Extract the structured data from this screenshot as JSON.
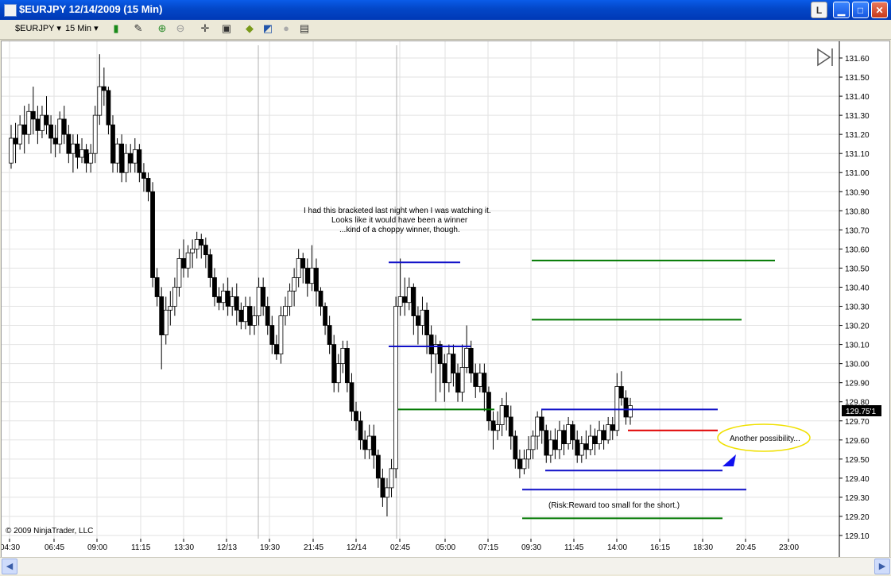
{
  "window": {
    "title": "$EURJPY  12/14/2009 (15 Min)",
    "btn_l": "L",
    "btn_min": "▁",
    "btn_max": "□",
    "btn_close": "✕"
  },
  "toolbar": {
    "instrument": "$EURJPY",
    "interval": "15 Min"
  },
  "chart": {
    "copyright": "© 2009 NinjaTrader, LLC",
    "last_price": "129.75'1",
    "annotation_lines": [
      "I had this bracketed last night when I was watching it.",
      "Looks like it would have been a winner",
      "...kind of a choppy winner, though."
    ],
    "possibility_label": "Another possibility...",
    "risk_note": "(Risk:Reward too small for the short.)",
    "price_labels": [
      "131.60",
      "131.50",
      "131.40",
      "131.30",
      "131.20",
      "131.10",
      "131.00",
      "130.90",
      "130.80",
      "130.70",
      "130.60",
      "130.50",
      "130.40",
      "130.30",
      "130.20",
      "130.10",
      "130.00",
      "129.90",
      "129.80",
      "129.70",
      "129.60",
      "129.50",
      "129.40",
      "129.30",
      "129.20",
      "129.10"
    ],
    "time_labels": [
      "04:30",
      "06:45",
      "09:00",
      "11:15",
      "13:30",
      "12/13",
      "19:30",
      "21:45",
      "12/14",
      "02:45",
      "05:00",
      "07:15",
      "09:30",
      "11:45",
      "14:00",
      "16:15",
      "18:30",
      "20:45",
      "23:00"
    ],
    "colors": {
      "blue": "#1010c8",
      "green": "#007800",
      "red": "#e00000",
      "ellipse": "#f0e000"
    }
  },
  "chart_data": {
    "type": "candlestick",
    "y_axis_range": [
      129.1,
      131.65
    ],
    "hlines": [
      {
        "color": "blue",
        "price": 130.53
      },
      {
        "color": "blue",
        "price": 130.09
      },
      {
        "color": "green",
        "price": 129.76
      },
      {
        "color": "green",
        "price": 130.54
      },
      {
        "color": "green",
        "price": 130.23
      },
      {
        "color": "blue",
        "price": 129.76
      },
      {
        "color": "red",
        "price": 129.65
      },
      {
        "color": "blue",
        "price": 129.44
      },
      {
        "color": "blue",
        "price": 129.34
      },
      {
        "color": "green",
        "price": 129.19
      }
    ],
    "candles": [
      [
        131.05,
        131.18,
        131.25,
        131.02
      ],
      [
        131.18,
        131.15,
        131.26,
        131.05
      ],
      [
        131.15,
        131.25,
        131.3,
        131.12
      ],
      [
        131.25,
        131.2,
        131.35,
        131.1
      ],
      [
        131.2,
        131.32,
        131.36,
        131.15
      ],
      [
        131.32,
        131.28,
        131.45,
        131.2
      ],
      [
        131.28,
        131.22,
        131.35,
        131.15
      ],
      [
        131.22,
        131.3,
        131.35,
        131.18
      ],
      [
        131.3,
        131.25,
        131.4,
        131.2
      ],
      [
        131.25,
        131.18,
        131.3,
        131.1
      ],
      [
        131.18,
        131.15,
        131.25,
        131.08
      ],
      [
        131.15,
        131.28,
        131.32,
        131.1
      ],
      [
        131.28,
        131.2,
        131.35,
        131.15
      ],
      [
        131.2,
        131.1,
        131.25,
        131.05
      ],
      [
        131.1,
        131.15,
        131.2,
        131.0
      ],
      [
        131.15,
        131.08,
        131.2,
        131.02
      ],
      [
        131.08,
        131.12,
        131.18,
        131.05
      ],
      [
        131.12,
        131.05,
        131.15,
        131.0
      ],
      [
        131.05,
        131.1,
        131.15,
        131.0
      ],
      [
        131.1,
        131.3,
        131.35,
        131.05
      ],
      [
        131.3,
        131.45,
        131.62,
        131.25
      ],
      [
        131.45,
        131.43,
        131.55,
        131.35
      ],
      [
        131.43,
        131.25,
        131.45,
        131.2
      ],
      [
        131.25,
        131.05,
        131.3,
        131.0
      ],
      [
        131.05,
        131.15,
        131.18,
        131.0
      ],
      [
        131.15,
        131.0,
        131.2,
        130.95
      ],
      [
        131.0,
        131.1,
        131.15,
        130.95
      ],
      [
        131.1,
        131.05,
        131.15,
        131.0
      ],
      [
        131.05,
        131.12,
        131.18,
        131.0
      ],
      [
        131.12,
        131.0,
        131.15,
        130.95
      ],
      [
        131.0,
        130.97,
        131.05,
        130.9
      ],
      [
        130.97,
        130.9,
        131.0,
        130.85
      ],
      [
        130.9,
        130.45,
        130.95,
        130.4
      ],
      [
        130.45,
        130.35,
        130.5,
        130.3
      ],
      [
        130.35,
        130.15,
        130.4,
        129.97
      ],
      [
        130.15,
        130.28,
        130.35,
        130.1
      ],
      [
        130.28,
        130.3,
        130.38,
        130.2
      ],
      [
        130.3,
        130.4,
        130.45,
        130.25
      ],
      [
        130.4,
        130.55,
        130.6,
        130.35
      ],
      [
        130.55,
        130.5,
        130.65,
        130.45
      ],
      [
        130.5,
        130.58,
        130.62,
        130.45
      ],
      [
        130.58,
        130.6,
        130.65,
        130.5
      ],
      [
        130.6,
        130.65,
        130.69,
        130.55
      ],
      [
        130.65,
        130.62,
        130.68,
        130.55
      ],
      [
        130.62,
        130.57,
        130.66,
        130.5
      ],
      [
        130.57,
        130.45,
        130.6,
        130.4
      ],
      [
        130.45,
        130.35,
        130.5,
        130.3
      ],
      [
        130.35,
        130.32,
        130.4,
        130.28
      ],
      [
        130.32,
        130.38,
        130.42,
        130.28
      ],
      [
        130.38,
        130.3,
        130.45,
        130.25
      ],
      [
        130.3,
        130.35,
        130.4,
        130.25
      ],
      [
        130.35,
        130.28,
        130.42,
        130.2
      ],
      [
        130.28,
        130.22,
        130.32,
        130.18
      ],
      [
        130.22,
        130.3,
        130.35,
        130.18
      ],
      [
        130.3,
        130.2,
        130.35,
        130.15
      ],
      [
        130.2,
        130.25,
        130.3,
        130.15
      ],
      [
        130.25,
        130.4,
        130.45,
        130.2
      ],
      [
        130.4,
        130.3,
        130.45,
        130.25
      ],
      [
        130.3,
        130.2,
        130.35,
        130.15
      ],
      [
        130.2,
        130.1,
        130.25,
        130.05
      ],
      [
        130.1,
        130.05,
        130.15,
        130.02
      ],
      [
        130.05,
        130.25,
        130.3,
        130.0
      ],
      [
        130.25,
        130.3,
        130.35,
        130.2
      ],
      [
        130.3,
        130.38,
        130.42,
        130.25
      ],
      [
        130.38,
        130.45,
        130.5,
        130.3
      ],
      [
        130.45,
        130.55,
        130.6,
        130.4
      ],
      [
        130.55,
        130.5,
        130.58,
        130.42
      ],
      [
        130.5,
        130.42,
        130.55,
        130.35
      ],
      [
        130.42,
        130.5,
        130.62,
        130.38
      ],
      [
        130.5,
        130.38,
        130.55,
        130.3
      ],
      [
        130.38,
        130.3,
        130.4,
        130.25
      ],
      [
        130.3,
        130.2,
        130.32,
        130.15
      ],
      [
        130.2,
        130.1,
        130.25,
        130.05
      ],
      [
        130.1,
        129.9,
        130.15,
        129.85
      ],
      [
        129.9,
        130.0,
        130.05,
        129.85
      ],
      [
        130.0,
        130.08,
        130.12,
        129.95
      ],
      [
        130.08,
        129.9,
        130.12,
        129.85
      ],
      [
        129.9,
        129.75,
        129.95,
        129.7
      ],
      [
        129.75,
        129.7,
        129.8,
        129.65
      ],
      [
        129.7,
        129.6,
        129.75,
        129.55
      ],
      [
        129.6,
        129.55,
        129.65,
        129.5
      ],
      [
        129.55,
        129.62,
        129.68,
        129.5
      ],
      [
        129.62,
        129.52,
        129.68,
        129.45
      ],
      [
        129.52,
        129.4,
        129.55,
        129.35
      ],
      [
        129.4,
        129.3,
        129.45,
        129.25
      ],
      [
        129.3,
        129.35,
        129.4,
        129.2
      ],
      [
        129.35,
        129.45,
        129.5,
        129.3
      ],
      [
        129.45,
        130.3,
        130.35,
        129.4
      ],
      [
        130.3,
        130.35,
        130.55,
        130.25
      ],
      [
        130.35,
        130.32,
        130.45,
        130.25
      ],
      [
        130.32,
        130.4,
        130.45,
        130.28
      ],
      [
        130.4,
        130.25,
        130.42,
        130.15
      ],
      [
        130.25,
        130.2,
        130.3,
        130.1
      ],
      [
        130.2,
        130.28,
        130.35,
        130.15
      ],
      [
        130.28,
        130.15,
        130.32,
        130.05
      ],
      [
        130.15,
        130.05,
        130.2,
        129.95
      ],
      [
        130.05,
        130.1,
        130.15,
        129.8
      ],
      [
        130.1,
        130.0,
        130.12,
        129.85
      ],
      [
        130.0,
        129.9,
        130.05,
        129.8
      ],
      [
        129.9,
        130.05,
        130.1,
        129.85
      ],
      [
        130.05,
        129.95,
        130.1,
        129.88
      ],
      [
        129.95,
        129.85,
        130.0,
        129.8
      ],
      [
        129.85,
        129.98,
        130.1,
        129.8
      ],
      [
        129.98,
        130.08,
        130.2,
        129.95
      ],
      [
        130.08,
        129.95,
        130.12,
        129.9
      ],
      [
        129.95,
        129.88,
        130.0,
        129.82
      ],
      [
        129.88,
        129.95,
        130.0,
        129.85
      ],
      [
        129.95,
        129.85,
        130.0,
        129.75
      ],
      [
        129.85,
        129.7,
        129.88,
        129.65
      ],
      [
        129.7,
        129.65,
        129.75,
        129.55
      ],
      [
        129.65,
        129.68,
        129.75,
        129.6
      ],
      [
        129.68,
        129.78,
        129.82,
        129.62
      ],
      [
        129.78,
        129.72,
        129.85,
        129.65
      ],
      [
        129.72,
        129.62,
        129.78,
        129.55
      ],
      [
        129.62,
        129.5,
        129.65,
        129.45
      ],
      [
        129.5,
        129.45,
        129.55,
        129.4
      ],
      [
        129.45,
        129.5,
        129.55,
        129.42
      ],
      [
        129.5,
        129.55,
        129.62,
        129.45
      ],
      [
        129.55,
        129.62,
        129.65,
        129.5
      ],
      [
        129.62,
        129.72,
        129.75,
        129.55
      ],
      [
        129.72,
        129.65,
        129.76,
        129.58
      ],
      [
        129.65,
        129.52,
        129.68,
        129.48
      ],
      [
        129.52,
        129.6,
        129.65,
        129.48
      ],
      [
        129.6,
        129.55,
        129.66,
        129.5
      ],
      [
        129.55,
        129.65,
        129.7,
        129.5
      ],
      [
        129.65,
        129.58,
        129.68,
        129.52
      ],
      [
        129.58,
        129.68,
        129.72,
        129.55
      ],
      [
        129.68,
        129.6,
        129.7,
        129.55
      ],
      [
        129.6,
        129.52,
        129.65,
        129.48
      ],
      [
        129.52,
        129.58,
        129.62,
        129.48
      ],
      [
        129.58,
        129.55,
        129.65,
        129.5
      ],
      [
        129.55,
        129.62,
        129.68,
        129.52
      ],
      [
        129.62,
        129.58,
        129.66,
        129.52
      ],
      [
        129.58,
        129.65,
        129.7,
        129.55
      ],
      [
        129.65,
        129.6,
        129.68,
        129.55
      ],
      [
        129.6,
        129.68,
        129.72,
        129.58
      ],
      [
        129.68,
        129.65,
        129.72,
        129.6
      ],
      [
        129.65,
        129.88,
        129.95,
        129.62
      ],
      [
        129.88,
        129.82,
        129.96,
        129.78
      ],
      [
        129.82,
        129.72,
        129.86,
        129.68
      ],
      [
        129.72,
        129.78,
        129.82,
        129.68
      ]
    ]
  }
}
